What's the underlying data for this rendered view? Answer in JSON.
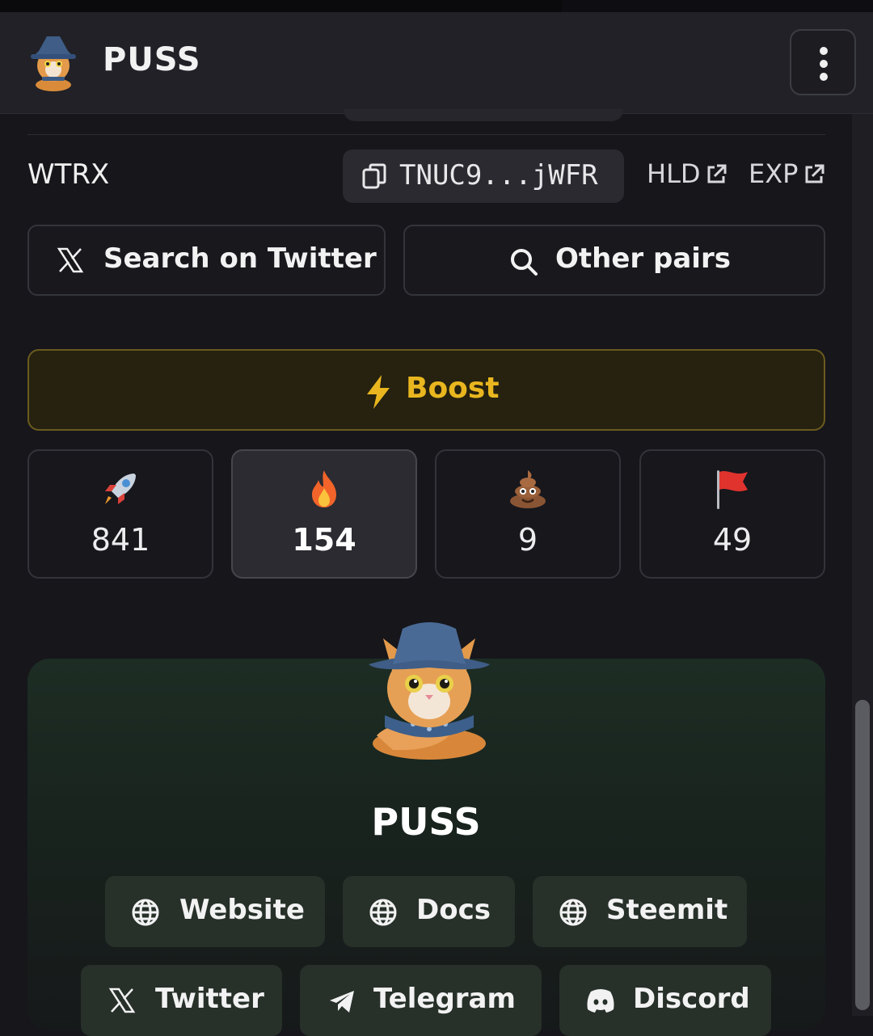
{
  "header": {
    "title": "PUSS",
    "avatar_icon": "cat-wizard-avatar"
  },
  "pair": {
    "quote_token": "WTRX",
    "address_short": "TNUC9...jWFR",
    "links": [
      {
        "label": "HLD",
        "icon": "external-link-icon"
      },
      {
        "label": "EXP",
        "icon": "external-link-icon"
      }
    ]
  },
  "actions": {
    "search_twitter": "Search on Twitter",
    "other_pairs": "Other pairs",
    "boost": "Boost"
  },
  "reactions": [
    {
      "emoji": "rocket",
      "count": "841"
    },
    {
      "emoji": "fire",
      "count": "154",
      "selected": true
    },
    {
      "emoji": "poop",
      "count": "9"
    },
    {
      "emoji": "red-flag",
      "count": "49"
    }
  ],
  "token_info": {
    "name": "PUSS",
    "links": [
      {
        "label": "Website",
        "icon": "globe-icon"
      },
      {
        "label": "Docs",
        "icon": "globe-icon"
      },
      {
        "label": "Steemit",
        "icon": "globe-icon"
      },
      {
        "label": "Twitter",
        "icon": "x-logo-icon"
      },
      {
        "label": "Telegram",
        "icon": "telegram-icon"
      },
      {
        "label": "Discord",
        "icon": "discord-icon"
      }
    ]
  },
  "colors": {
    "boost_accent": "#e9b61f",
    "background": "#16161b",
    "header": "#212127"
  }
}
